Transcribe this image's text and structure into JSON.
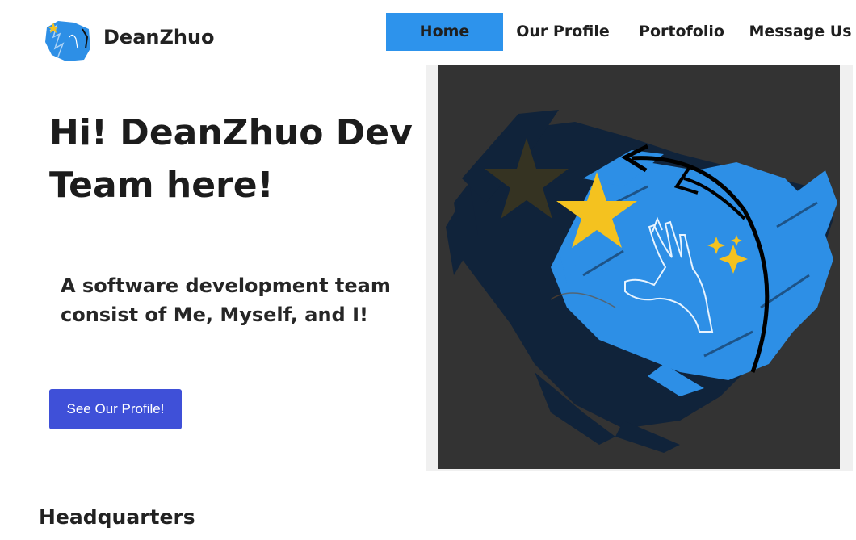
{
  "header": {
    "brand_name": "DeanZhuo",
    "nav": {
      "home": "Home",
      "profile": "Our Profile",
      "portfolio": "Portofolio",
      "message": "Message Us"
    }
  },
  "hero": {
    "title_line1": "Hi! DeanZhuo Dev",
    "title_line2": "Team here!",
    "subtitle_line1": "A software development team",
    "subtitle_line2": "consist of Me, Myself, and I!",
    "cta_label": "See Our Profile!"
  },
  "sections": {
    "headquarters_title": "Headquarters"
  },
  "colors": {
    "nav_active_bg": "#2d93ec",
    "cta_bg": "#3f50d8",
    "image_bg": "#333333",
    "brush_blue": "#2d8fe6",
    "brush_dark": "#10233a",
    "star_yellow": "#f4c21f"
  },
  "icons": {
    "logo": "brand-logo-icon",
    "hero": "hand-with-stars-illustration"
  }
}
